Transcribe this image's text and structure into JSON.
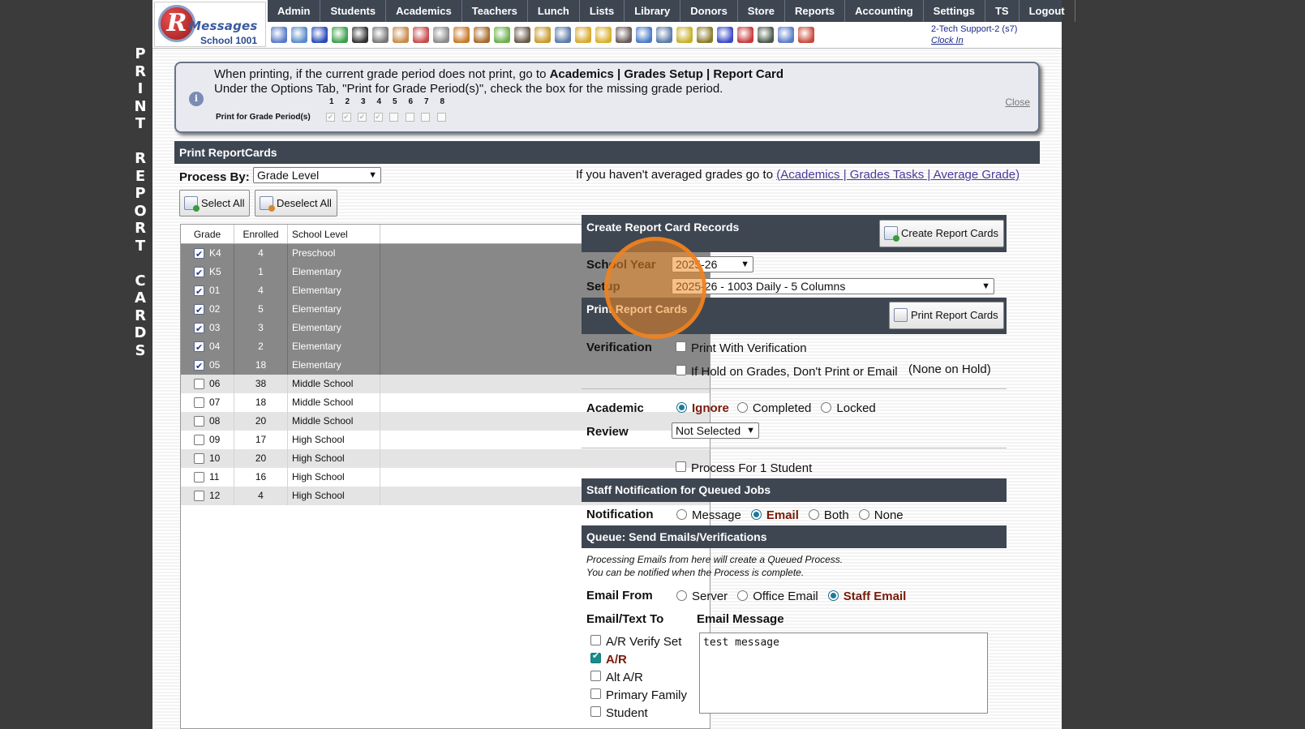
{
  "sidebar_title": [
    "P",
    "R",
    "I",
    "N",
    "T",
    "",
    "R",
    "E",
    "P",
    "O",
    "R",
    "T",
    "",
    "C",
    "A",
    "R",
    "D",
    "S"
  ],
  "logo": {
    "letter": "R",
    "name": "Messages",
    "school": "School 1001"
  },
  "nav": [
    "Admin",
    "Students",
    "Academics",
    "Teachers",
    "Lunch",
    "Lists",
    "Library",
    "Donors",
    "Store",
    "Reports",
    "Accounting",
    "Settings",
    "TS",
    "Logout"
  ],
  "toolbar_icons": [
    {
      "name": "search-icon",
      "color": "#5a7ac8"
    },
    {
      "name": "calendar-grid-icon",
      "color": "#5a8ac8"
    },
    {
      "name": "at-sign-icon",
      "color": "#2a4ab8"
    },
    {
      "name": "chat-bubbles-icon",
      "color": "#3aa04a"
    },
    {
      "name": "phone-icon",
      "color": "#333333"
    },
    {
      "name": "speaker-icon",
      "color": "#777777"
    },
    {
      "name": "newsletter-icon",
      "color": "#c88a4a"
    },
    {
      "name": "calendar-icon",
      "color": "#c84a4a"
    },
    {
      "name": "megaphone-icon",
      "color": "#8a8a8a"
    },
    {
      "name": "teacher-icon",
      "color": "#c87a2a"
    },
    {
      "name": "student-icon",
      "color": "#a86a2a"
    },
    {
      "name": "eraser-icon",
      "color": "#6ab04a"
    },
    {
      "name": "group-icon",
      "color": "#6a5a4a"
    },
    {
      "name": "lunch-tray-icon",
      "color": "#c89a2a"
    },
    {
      "name": "book-icon",
      "color": "#5a7aa8"
    },
    {
      "name": "tag-icon",
      "color": "#d8a82a"
    },
    {
      "name": "folder-arrow-icon",
      "color": "#d8b02a"
    },
    {
      "name": "person-icon",
      "color": "#6a5a5a"
    },
    {
      "name": "clock-icon",
      "color": "#4a7ac8"
    },
    {
      "name": "report-icon",
      "color": "#5a7aa8"
    },
    {
      "name": "card-icon",
      "color": "#c8b02a"
    },
    {
      "name": "printer-money-icon",
      "color": "#8a7a2a"
    },
    {
      "name": "ap-icon",
      "color": "#3a4ac8"
    },
    {
      "name": "pdf-icon",
      "color": "#c83a3a"
    },
    {
      "name": "cash-register-icon",
      "color": "#4a5a4a"
    },
    {
      "name": "help-icon",
      "color": "#5a7ac8"
    },
    {
      "name": "power-icon",
      "color": "#c84a3a"
    }
  ],
  "user": {
    "name": "2-Tech Support-2 (s7)",
    "clock_in": "Clock In"
  },
  "notice": {
    "line1_prefix": "When printing, if the current grade period does not print, go to ",
    "line1_bold": "Academics | Grades Setup | Report Card",
    "line2": "Under the Options Tab, \"Print for Grade Period(s)\", check the box for the missing grade period.",
    "period_label": "Print for Grade Period(s)",
    "periods": [
      "1",
      "2",
      "3",
      "4",
      "5",
      "6",
      "7",
      "8"
    ],
    "close": "Close"
  },
  "section_title": "Print ReportCards",
  "process_by": {
    "label": "Process By:",
    "value": "Grade Level"
  },
  "avg_note": {
    "prefix": "If you haven't averaged grades go to ",
    "link": "(Academics | Grades Tasks | Average Grade)"
  },
  "buttons": {
    "select_all": "Select All",
    "deselect_all": "Deselect All",
    "create": "Create Report Cards",
    "print": "Print Report Cards"
  },
  "grade_table": {
    "headers": [
      "Grade",
      "Enrolled",
      "School Level"
    ],
    "rows": [
      {
        "grade": "K4",
        "enrolled": "4",
        "level": "Preschool",
        "checked": true
      },
      {
        "grade": "K5",
        "enrolled": "1",
        "level": "Elementary",
        "checked": true
      },
      {
        "grade": "01",
        "enrolled": "4",
        "level": "Elementary",
        "checked": true
      },
      {
        "grade": "02",
        "enrolled": "5",
        "level": "Elementary",
        "checked": true
      },
      {
        "grade": "03",
        "enrolled": "3",
        "level": "Elementary",
        "checked": true
      },
      {
        "grade": "04",
        "enrolled": "2",
        "level": "Elementary",
        "checked": true
      },
      {
        "grade": "05",
        "enrolled": "18",
        "level": "Elementary",
        "checked": true
      },
      {
        "grade": "06",
        "enrolled": "38",
        "level": "Middle School",
        "checked": false
      },
      {
        "grade": "07",
        "enrolled": "18",
        "level": "Middle School",
        "checked": false
      },
      {
        "grade": "08",
        "enrolled": "20",
        "level": "Middle School",
        "checked": false
      },
      {
        "grade": "09",
        "enrolled": "17",
        "level": "High School",
        "checked": false
      },
      {
        "grade": "10",
        "enrolled": "20",
        "level": "High School",
        "checked": false
      },
      {
        "grade": "11",
        "enrolled": "16",
        "level": "High School",
        "checked": false
      },
      {
        "grade": "12",
        "enrolled": "4",
        "level": "High School",
        "checked": false
      }
    ]
  },
  "create_section": "Create Report Card Records",
  "school_year": {
    "label": "School Year",
    "value": "2025-26"
  },
  "setup": {
    "label": "Setup",
    "value": "2025-26 - 1003 Daily - 5 Columns"
  },
  "print_section": "Print Report Cards",
  "verification": {
    "label": "Verification",
    "opt1": "Print With Verification",
    "opt2": "If Hold on Grades, Don't Print or Email",
    "hold_note": "(None on Hold)"
  },
  "academic": {
    "label": "Academic",
    "options": [
      "Ignore",
      "Completed",
      "Locked"
    ],
    "selected": "Ignore"
  },
  "review": {
    "label": "Review",
    "value": "Not Selected"
  },
  "process_one": "Process For 1 Student",
  "staff_section": "Staff Notification for Queued Jobs",
  "notification": {
    "label": "Notification",
    "options": [
      "Message",
      "Email",
      "Both",
      "None"
    ],
    "selected": "Email"
  },
  "queue_section": "Queue: Send Emails/Verifications",
  "queue_note": [
    "Processing Emails from here will create a Queued Process.",
    "You can be notified when the Process is complete."
  ],
  "email_from": {
    "label": "Email From",
    "options": [
      "Server",
      "Office Email",
      "Staff Email"
    ],
    "selected": "Staff Email"
  },
  "email_to": {
    "label": "Email/Text To",
    "options": [
      {
        "label": "A/R Verify Set",
        "checked": false
      },
      {
        "label": "A/R",
        "checked": true
      },
      {
        "label": "Alt A/R",
        "checked": false
      },
      {
        "label": "Primary Family",
        "checked": false
      },
      {
        "label": "Student",
        "checked": false
      }
    ]
  },
  "email_message": {
    "label": "Email Message",
    "value": "test message"
  }
}
